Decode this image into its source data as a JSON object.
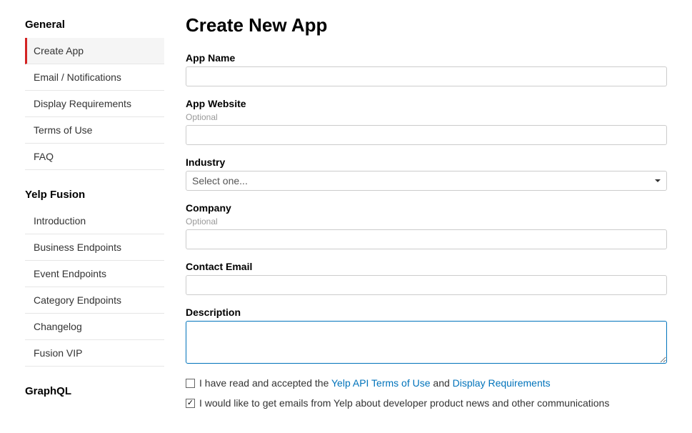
{
  "sidebar": {
    "sections": [
      {
        "title": "General",
        "items": [
          {
            "label": "Create App",
            "active": true
          },
          {
            "label": "Email / Notifications",
            "active": false
          },
          {
            "label": "Display Requirements",
            "active": false
          },
          {
            "label": "Terms of Use",
            "active": false
          },
          {
            "label": "FAQ",
            "active": false
          }
        ]
      },
      {
        "title": "Yelp Fusion",
        "items": [
          {
            "label": "Introduction",
            "active": false
          },
          {
            "label": "Business Endpoints",
            "active": false
          },
          {
            "label": "Event Endpoints",
            "active": false
          },
          {
            "label": "Category Endpoints",
            "active": false
          },
          {
            "label": "Changelog",
            "active": false
          },
          {
            "label": "Fusion VIP",
            "active": false
          }
        ]
      },
      {
        "title": "GraphQL",
        "items": []
      }
    ]
  },
  "page": {
    "title": "Create New App"
  },
  "form": {
    "app_name": {
      "label": "App Name",
      "value": ""
    },
    "app_website": {
      "label": "App Website",
      "hint": "Optional",
      "value": ""
    },
    "industry": {
      "label": "Industry",
      "selected": "Select one..."
    },
    "company": {
      "label": "Company",
      "hint": "Optional",
      "value": ""
    },
    "contact_email": {
      "label": "Contact Email",
      "value": ""
    },
    "description": {
      "label": "Description",
      "value": ""
    },
    "terms": {
      "checked": false,
      "text_before": "I have read and accepted the ",
      "link1": "Yelp API Terms of Use",
      "text_between": " and ",
      "link2": "Display Requirements"
    },
    "emails": {
      "checked": true,
      "text": "I would like to get emails from Yelp about developer product news and other communications"
    }
  }
}
